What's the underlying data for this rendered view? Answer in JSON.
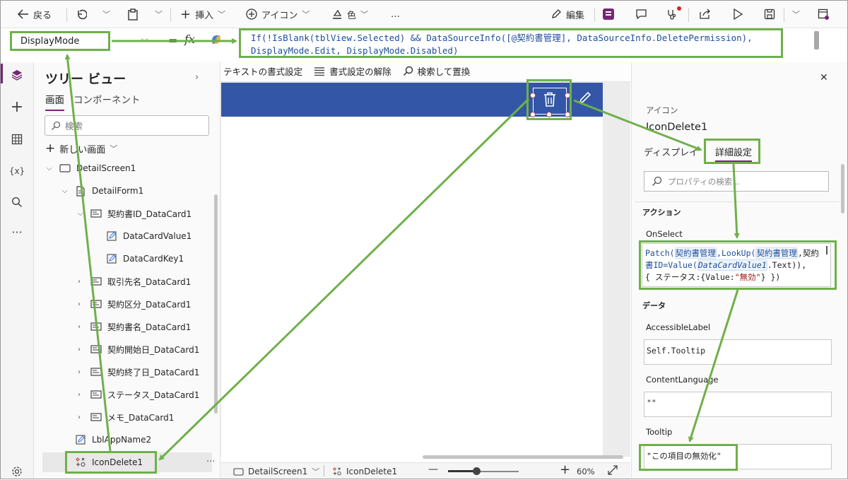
{
  "toolbar": {
    "back_label": "戻る",
    "insert_label": "挿入",
    "icon_label": "アイコン",
    "color_label": "色",
    "more_label": "…",
    "edit_label": "編集"
  },
  "formula_bar": {
    "property": "DisplayMode",
    "equals": "=",
    "fx": "fx",
    "formula_line1": "If(!IsBlank(tblView.Selected) && DataSourceInfo([@契約書管理], DataSourceInfo.DeletePermission),",
    "formula_line2": "DisplayMode.Edit, DisplayMode.Disabled)"
  },
  "format_toolbar": {
    "format_text": "テキストの書式設定",
    "remove_format": "書式設定の解除",
    "find_replace": "検索して置換"
  },
  "tree": {
    "title": "ツリー ビュー",
    "tabs": [
      "画面",
      "コンポーネント"
    ],
    "search_placeholder": "検索",
    "new_screen": "新しい画面",
    "items": [
      {
        "label": "DetailScreen1"
      },
      {
        "label": "DetailForm1"
      },
      {
        "label": "契約書ID_DataCard1"
      },
      {
        "label": "DataCardValue1"
      },
      {
        "label": "DataCardKey1"
      },
      {
        "label": "取引先名_DataCard1"
      },
      {
        "label": "契約区分_DataCard1"
      },
      {
        "label": "契約書名_DataCard1"
      },
      {
        "label": "契約開始日_DataCard1"
      },
      {
        "label": "契約終了日_DataCard1"
      },
      {
        "label": "ステータス_DataCard1"
      },
      {
        "label": "メモ_DataCard1"
      },
      {
        "label": "LblAppName2"
      },
      {
        "label": "IconDelete1"
      }
    ],
    "more": "···"
  },
  "statusbar": {
    "screen": "DetailScreen1",
    "control": "IconDelete1",
    "zoom_label": "60%",
    "zoom_fraction": 0.4
  },
  "properties": {
    "type_label": "アイコン",
    "control_name": "IconDelete1",
    "tab_display": "ディスプレイ",
    "tab_advanced": "詳細設定",
    "search_placeholder": "プロパティの検索...",
    "section_action": "アクション",
    "onselect_label": "OnSelect",
    "onselect_parts": {
      "l1a": "Patch(",
      "l1b": "契約書管理",
      "l1c": ",LookUp(",
      "l1d": "契約書管理",
      "l1e": ",契約",
      "l2a": "書ID=Value(",
      "l2b": "DataCardValue1",
      "l2c": ".Text)),",
      "l3a": " { ステータス:{Value:",
      "l3b": "\"無効\"",
      "l3c": "} })"
    },
    "section_data": "データ",
    "accessible_label": "AccessibleLabel",
    "accessible_value": "Self.Tooltip",
    "content_language_label": "ContentLanguage",
    "content_language_value": "\"\"",
    "tooltip_label": "Tooltip",
    "tooltip_value": "\"この項目の無効化\""
  },
  "colors": {
    "annotation_green": "#6fb04a",
    "header_blue": "#3356a6",
    "accent_purple": "#742774"
  }
}
